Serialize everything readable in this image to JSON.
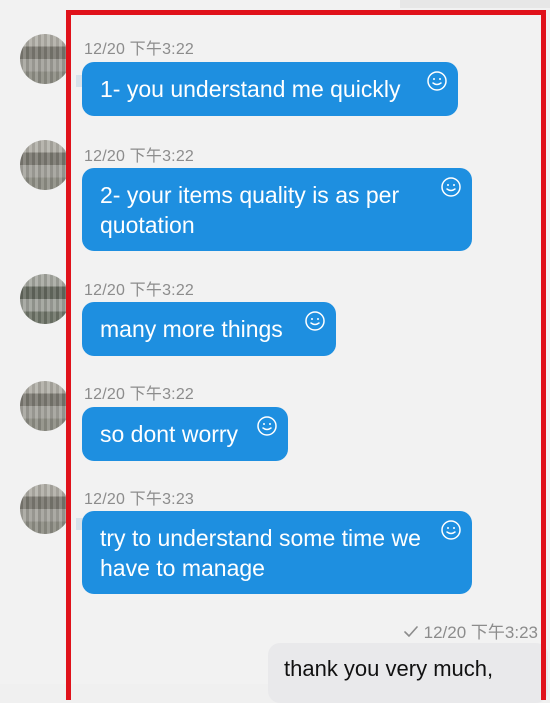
{
  "conversation": {
    "messages": [
      {
        "timestamp": "12/20 下午3:22",
        "text": "1- you understand me quickly",
        "emoji": "smiley-icon"
      },
      {
        "timestamp": "12/20 下午3:22",
        "text": "2-  your items quality is as per quotation",
        "emoji": "smiley-icon"
      },
      {
        "timestamp": "12/20 下午3:22",
        "text": "many more things",
        "emoji": "smiley-icon"
      },
      {
        "timestamp": "12/20 下午3:22",
        "text": "so dont worry",
        "emoji": "smiley-icon"
      },
      {
        "timestamp": "12/20 下午3:23",
        "text": "try to understand some time we have to manage",
        "emoji": "smiley-icon"
      }
    ],
    "sent": {
      "status_icon": "check-icon",
      "timestamp": "12/20 下午3:23",
      "text": "thank you very much,"
    }
  },
  "colors": {
    "bubble_blue": "#1e8fe0",
    "highlight_red": "#e0121b",
    "sent_bubble": "#e9e9eb"
  }
}
